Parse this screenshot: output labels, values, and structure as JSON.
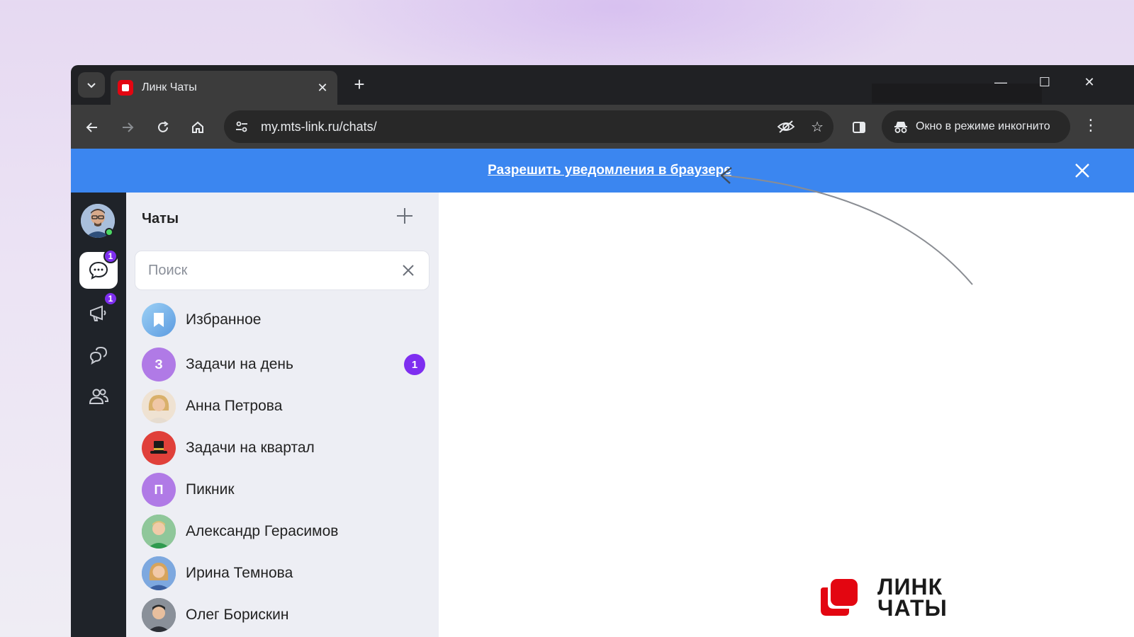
{
  "browser": {
    "tab_title": "Линк Чаты",
    "url": "my.mts-link.ru/chats/",
    "incognito_label": "Окно в режиме инкогнито"
  },
  "notification": {
    "link_text": "Разрешить уведомления в браузере"
  },
  "rail": {
    "chats_badge": "1",
    "announcements_badge": "1"
  },
  "chatlist": {
    "title": "Чаты",
    "search_placeholder": "Поиск",
    "items": [
      {
        "name": "Избранное",
        "initial": "",
        "color": "#7fb8ea"
      },
      {
        "name": "Задачи на день",
        "initial": "З",
        "color": "#b07ae6",
        "count": "1"
      },
      {
        "name": "Анна Петрова",
        "initial": "",
        "color": "#e8c9a4"
      },
      {
        "name": "Задачи на квартал",
        "initial": "",
        "color": "#e0403a"
      },
      {
        "name": "Пикник",
        "initial": "П",
        "color": "#b07ae6"
      },
      {
        "name": "Александр Герасимов",
        "initial": "",
        "color": "#5fae6e"
      },
      {
        "name": "Ирина Темнова",
        "initial": "",
        "color": "#6f9fd8"
      },
      {
        "name": "Олег Борискин",
        "initial": "",
        "color": "#5d6570"
      }
    ]
  },
  "logo": {
    "line1": "ЛИНК",
    "line2": "ЧАТЫ"
  },
  "colors": {
    "accent_blue": "#3b86f0",
    "badge_purple": "#7e2ef0",
    "brand_red": "#e30611"
  }
}
